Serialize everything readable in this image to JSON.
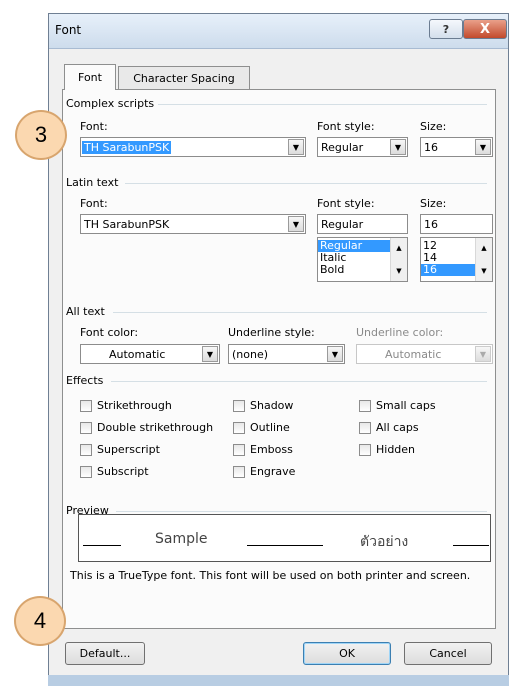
{
  "window": {
    "title": "Font",
    "help_glyph": "?",
    "close_glyph": "X"
  },
  "tabs": [
    {
      "label": "Font"
    },
    {
      "label": "Character Spacing"
    }
  ],
  "complex_scripts": {
    "heading": "Complex scripts",
    "font_label": "Font:",
    "font_value": "TH SarabunPSK",
    "style_label": "Font style:",
    "style_value": "Regular",
    "size_label": "Size:",
    "size_value": "16"
  },
  "latin_text": {
    "heading": "Latin text",
    "font_label": "Font:",
    "font_value": "TH SarabunPSK",
    "style_label": "Font style:",
    "style_value": "Regular",
    "style_options": [
      "Regular",
      "Italic",
      "Bold"
    ],
    "size_label": "Size:",
    "size_value": "16",
    "size_options": [
      "12",
      "14",
      "16"
    ]
  },
  "all_text": {
    "heading": "All text",
    "color_label": "Font color:",
    "color_value": "Automatic",
    "underline_label": "Underline style:",
    "underline_value": "(none)",
    "underline_color_label": "Underline color:",
    "underline_color_value": "Automatic"
  },
  "effects": {
    "heading": "Effects",
    "items": [
      "Strikethrough",
      "Double strikethrough",
      "Superscript",
      "Subscript",
      "Shadow",
      "Outline",
      "Emboss",
      "Engrave",
      "Small caps",
      "All caps",
      "Hidden"
    ]
  },
  "preview": {
    "heading": "Preview",
    "sample_latin": "Sample",
    "sample_thai": "ตัวอย่าง",
    "note": "This is a TrueType font. This font will be used on both printer and screen."
  },
  "buttons": {
    "default": "Default...",
    "ok": "OK",
    "cancel": "Cancel"
  },
  "badges": {
    "step3": "3",
    "step4": "4"
  },
  "colors": {
    "accent": "#3399ff",
    "badge_fill": "#fbd8b0"
  }
}
